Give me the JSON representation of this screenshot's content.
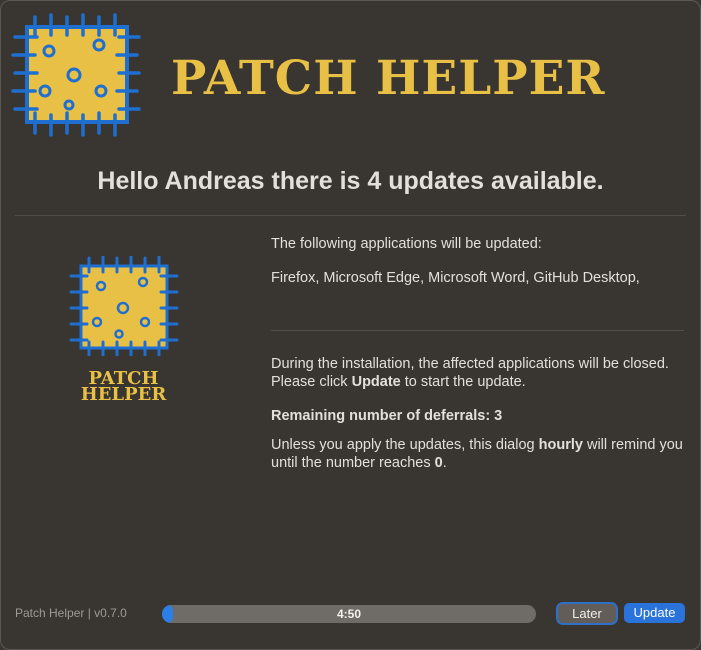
{
  "banner": {
    "title": "PATCH HELPER"
  },
  "headline": "Hello Andreas there is  4 updates  available.",
  "side_logo": {
    "line1": "PATCH",
    "line2": "HELPER"
  },
  "body": {
    "intro": "The following applications will be updated:",
    "apps": "Firefox, Microsoft Edge, Microsoft Word, GitHub Desktop,",
    "install_prefix": "During the installation, the affected applications will be closed. Please click ",
    "install_bold": "Update",
    "install_suffix": " to start the update.",
    "deferrals": "Remaining number of deferrals: 3",
    "remind_prefix": "Unless you apply the updates, this dialog ",
    "remind_bold": "hourly",
    "remind_mid": " will remind you until the number reaches ",
    "remind_bold2": "0",
    "remind_suffix": "."
  },
  "footer": {
    "version": "Patch Helper | v0.7.0",
    "timer": "4:50",
    "progress_fraction": 0.03,
    "later_label": "Later",
    "update_label": "Update"
  },
  "colors": {
    "accent": "#2a73db",
    "brand": "#e9c046",
    "logo_stitch": "#1f6fd1"
  }
}
